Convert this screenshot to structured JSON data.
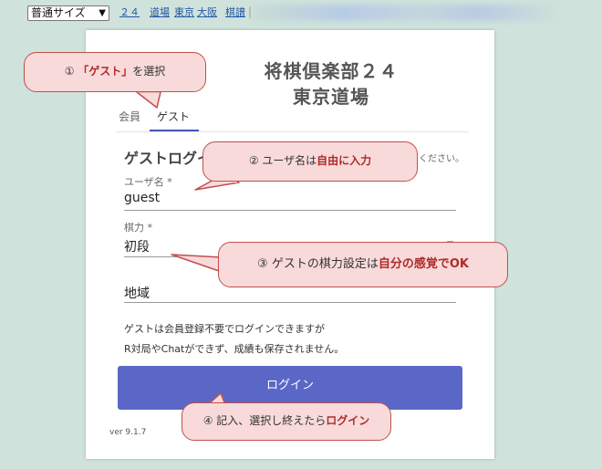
{
  "topbar": {
    "size_select": "普通サイズ",
    "links": [
      "２４",
      "道場",
      "東京",
      "大阪",
      "棋譜"
    ],
    "separator": "|"
  },
  "card": {
    "title_line1": "将棋倶楽部２４",
    "title_line2": "東京道場",
    "tabs": [
      "会員",
      "ゲスト"
    ],
    "section_title": "ゲストログイ",
    "section_hint": "手で入力ください。",
    "username_label": "ユーザ名 *",
    "username_value": "guest",
    "strength_label": "棋力 *",
    "strength_value": "初段",
    "region_value": "地域",
    "note_line1": "ゲストは会員登録不要でログインできますが",
    "note_line2": "R対局やChatができず、成績も保存されません。",
    "login_button": "ログイン",
    "version": "ver 9.1.7"
  },
  "callouts": {
    "c1": {
      "num": "①",
      "bold": "「ゲスト」",
      "rest": "を選択"
    },
    "c2": {
      "num": "②",
      "pre": "ユーザ名は",
      "bold": "自由に入力"
    },
    "c3": {
      "num": "③",
      "pre": "ゲストの棋力設定は",
      "bold": "自分の感覚でOK"
    },
    "c4": {
      "num": "④",
      "pre": "記入、選択し終えたら",
      "bold": "ログイン"
    }
  },
  "colors": {
    "background": "#cfe3dc",
    "button": "#5b67c7",
    "callout_fill": "#f8dada",
    "callout_border": "#c0504d",
    "tab_accent": "#4a57b8"
  }
}
